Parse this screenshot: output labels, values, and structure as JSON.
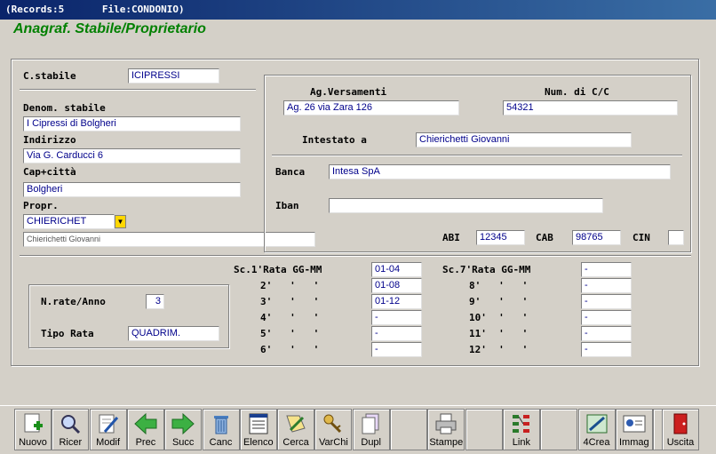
{
  "titlebar": {
    "records": "(Records:5",
    "file": "File:CONDONIO)"
  },
  "heading": "Anagraf. Stabile/Proprietario",
  "left": {
    "cstabile_label": "C.stabile",
    "cstabile_value": "ICIPRESSI",
    "denom_label": "Denom. stabile",
    "denom_value": "I Cipressi di Bolgheri",
    "indirizzo_label": "Indirizzo",
    "indirizzo_value": "Via G. Carducci 6",
    "cap_label": "Cap+città",
    "cap_value": "Bolgheri",
    "propr_label": "Propr.",
    "propr_value": "CHIERICHET",
    "propr_name": "Chierichetti Giovanni"
  },
  "bank": {
    "agvers_label": "Ag.Versamenti",
    "agvers_value": "Ag. 26 via Zara 126",
    "numcc_label": "Num. di C/C",
    "numcc_value": "54321",
    "intestato_label": "Intestato a",
    "intestato_value": "Chierichetti Giovanni",
    "banca_label": "Banca",
    "banca_value": "Intesa SpA",
    "iban_label": "Iban",
    "iban_value": "",
    "abi_label": "ABI",
    "abi_value": "12345",
    "cab_label": "CAB",
    "cab_value": "98765",
    "cin_label": "CIN",
    "cin_value": ""
  },
  "rate": {
    "nrate_label": "N.rate/Anno",
    "nrate_value": "3",
    "tipo_label": "Tipo Rata",
    "tipo_value": "QUADRIM.",
    "col1": [
      {
        "label": "Sc.1'Rata GG-MM",
        "value": "01-04"
      },
      {
        "label": "2'   '   '",
        "value": "01-08"
      },
      {
        "label": "3'   '   '",
        "value": "01-12"
      },
      {
        "label": "4'   '   '",
        "value": "-"
      },
      {
        "label": "5'   '   '",
        "value": "-"
      },
      {
        "label": "6'   '   '",
        "value": "-"
      }
    ],
    "col2": [
      {
        "label": "Sc.7'Rata GG-MM",
        "value": "-"
      },
      {
        "label": "8'   '   '",
        "value": "-"
      },
      {
        "label": "9'   '   '",
        "value": "-"
      },
      {
        "label": "10'  '   '",
        "value": "-"
      },
      {
        "label": "11'  '   '",
        "value": "-"
      },
      {
        "label": "12'  '   '",
        "value": "-"
      }
    ]
  },
  "toolbar": [
    {
      "name": "nuovo",
      "label": "Nuovo",
      "icon": "new-record-icon"
    },
    {
      "name": "ricer",
      "label": "Ricer",
      "icon": "search-icon"
    },
    {
      "name": "modif",
      "label": "Modif",
      "icon": "edit-icon"
    },
    {
      "name": "prec",
      "label": "Prec",
      "icon": "arrow-left-icon"
    },
    {
      "name": "succ",
      "label": "Succ",
      "icon": "arrow-right-icon"
    },
    {
      "name": "canc",
      "label": "Canc",
      "icon": "trash-icon"
    },
    {
      "name": "elenco",
      "label": "Elenco",
      "icon": "list-icon"
    },
    {
      "name": "cerca",
      "label": "Cerca",
      "icon": "find-icon"
    },
    {
      "name": "varchi",
      "label": "VarChi",
      "icon": "keys-icon"
    },
    {
      "name": "dupl",
      "label": "Dupl",
      "icon": "duplicate-icon"
    },
    {
      "name": "blank1",
      "label": "",
      "icon": ""
    },
    {
      "name": "stampe",
      "label": "Stampe",
      "icon": "printer-icon"
    },
    {
      "name": "blank2",
      "label": "",
      "icon": ""
    },
    {
      "name": "link",
      "label": "Link",
      "icon": "link-icon"
    },
    {
      "name": "blank3",
      "label": "",
      "icon": ""
    },
    {
      "name": "4crea",
      "label": "4Crea",
      "icon": "create-icon"
    },
    {
      "name": "immag",
      "label": "Immag",
      "icon": "image-icon"
    },
    {
      "name": "blank4",
      "label": "",
      "icon": ""
    },
    {
      "name": "uscita",
      "label": "Uscita",
      "icon": "exit-door-icon"
    }
  ]
}
